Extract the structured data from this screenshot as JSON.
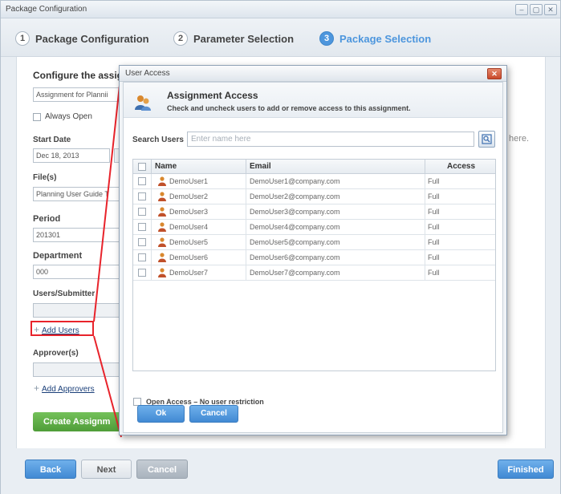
{
  "window": {
    "title": "Package Configuration",
    "buttons": [
      "–",
      "▢",
      "✕"
    ]
  },
  "steps": [
    {
      "num": "1",
      "label": "Package Configuration"
    },
    {
      "num": "2",
      "label": "Parameter Selection"
    },
    {
      "num": "3",
      "label": "Package Selection"
    }
  ],
  "config": {
    "title": "Configure the assig",
    "assignment_name": "Assignment for Plannii",
    "always_open_label": "Always Open",
    "start_date_label": "Start Date",
    "start_date_value": "Dec 18, 2013",
    "files_label": "File(s)",
    "files_value": "Planning User Guide T",
    "period_label": "Period",
    "period_value": "201301",
    "department_label": "Department",
    "department_value": "000",
    "users_label": "Users/Submitter",
    "add_users_label": "Add Users",
    "approvers_label": "Approver(s)",
    "add_approvers_label": "Add Approvers",
    "create_label": "Create Assignm",
    "drop_hint": "here."
  },
  "dialog": {
    "title": "User Access",
    "heading": "Assignment Access",
    "subheading": "Check and uncheck users to add or remove access to this assignment.",
    "search_label": "Search Users",
    "search_placeholder": "Enter name here",
    "columns": {
      "name": "Name",
      "email": "Email",
      "access": "Access"
    },
    "users": [
      {
        "name": "DemoUser1",
        "email": "DemoUser1@company.com",
        "access": "Full"
      },
      {
        "name": "DemoUser2",
        "email": "DemoUser2@company.com",
        "access": "Full"
      },
      {
        "name": "DemoUser3",
        "email": "DemoUser3@company.com",
        "access": "Full"
      },
      {
        "name": "DemoUser4",
        "email": "DemoUser4@company.com",
        "access": "Full"
      },
      {
        "name": "DemoUser5",
        "email": "DemoUser5@company.com",
        "access": "Full"
      },
      {
        "name": "DemoUser6",
        "email": "DemoUser6@company.com",
        "access": "Full"
      },
      {
        "name": "DemoUser7",
        "email": "DemoUser7@company.com",
        "access": "Full"
      }
    ],
    "open_access_label": "Open Access – No user restriction",
    "ok_label": "Ok",
    "cancel_label": "Cancel"
  },
  "footer": {
    "back_label": "Back",
    "next_label": "Next",
    "cancel_label": "Cancel",
    "finished_label": "Finished"
  },
  "colors": {
    "accent_blue": "#4d96dd",
    "create_green": "#5aa843",
    "callout_red": "#e8232b",
    "close_red": "#c9482a"
  }
}
